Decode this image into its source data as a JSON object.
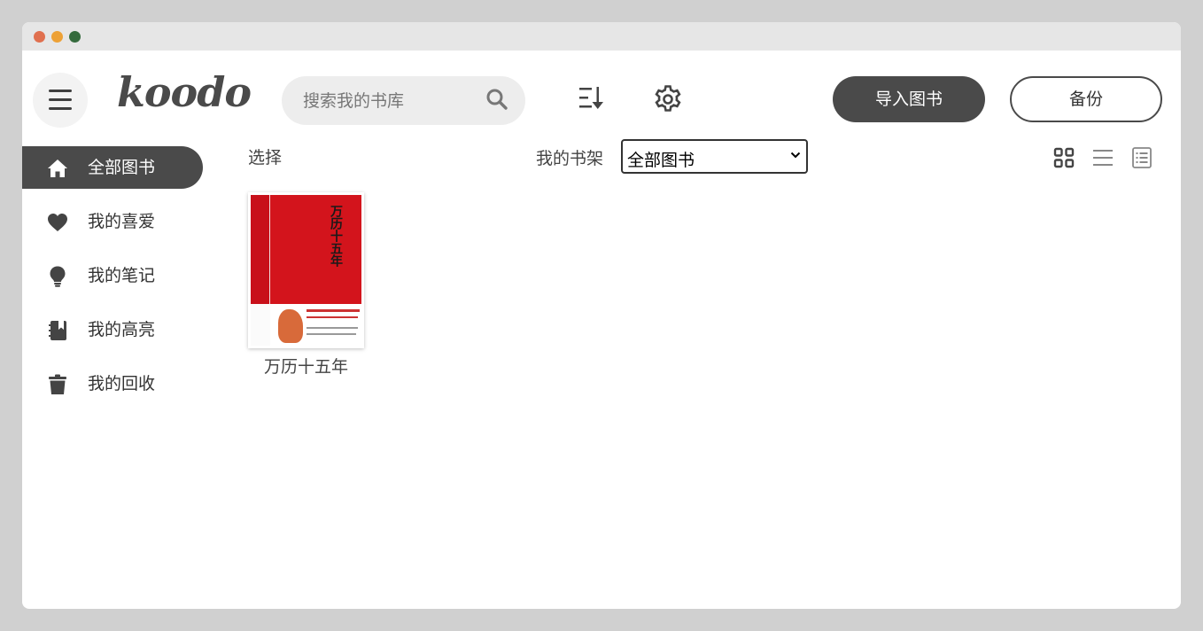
{
  "app": {
    "logo": "koodo"
  },
  "search": {
    "placeholder": "搜索我的书库"
  },
  "header": {
    "import_label": "导入图书",
    "backup_label": "备份"
  },
  "sidebar": {
    "items": [
      {
        "label": "全部图书",
        "icon": "home-icon",
        "active": true
      },
      {
        "label": "我的喜爱",
        "icon": "heart-icon",
        "active": false
      },
      {
        "label": "我的笔记",
        "icon": "lightbulb-icon",
        "active": false
      },
      {
        "label": "我的高亮",
        "icon": "notebook-icon",
        "active": false
      },
      {
        "label": "我的回收",
        "icon": "trash-icon",
        "active": false
      }
    ]
  },
  "toolbar": {
    "select_label": "选择",
    "shelf_label": "我的书架",
    "shelf_value": "全部图书"
  },
  "books": [
    {
      "title": "万历十五年",
      "cover_text": "万历十五年",
      "cover_color": "#d3141c"
    }
  ],
  "colors": {
    "accent": "#4a4a4a",
    "background": "#d0d0d0"
  }
}
